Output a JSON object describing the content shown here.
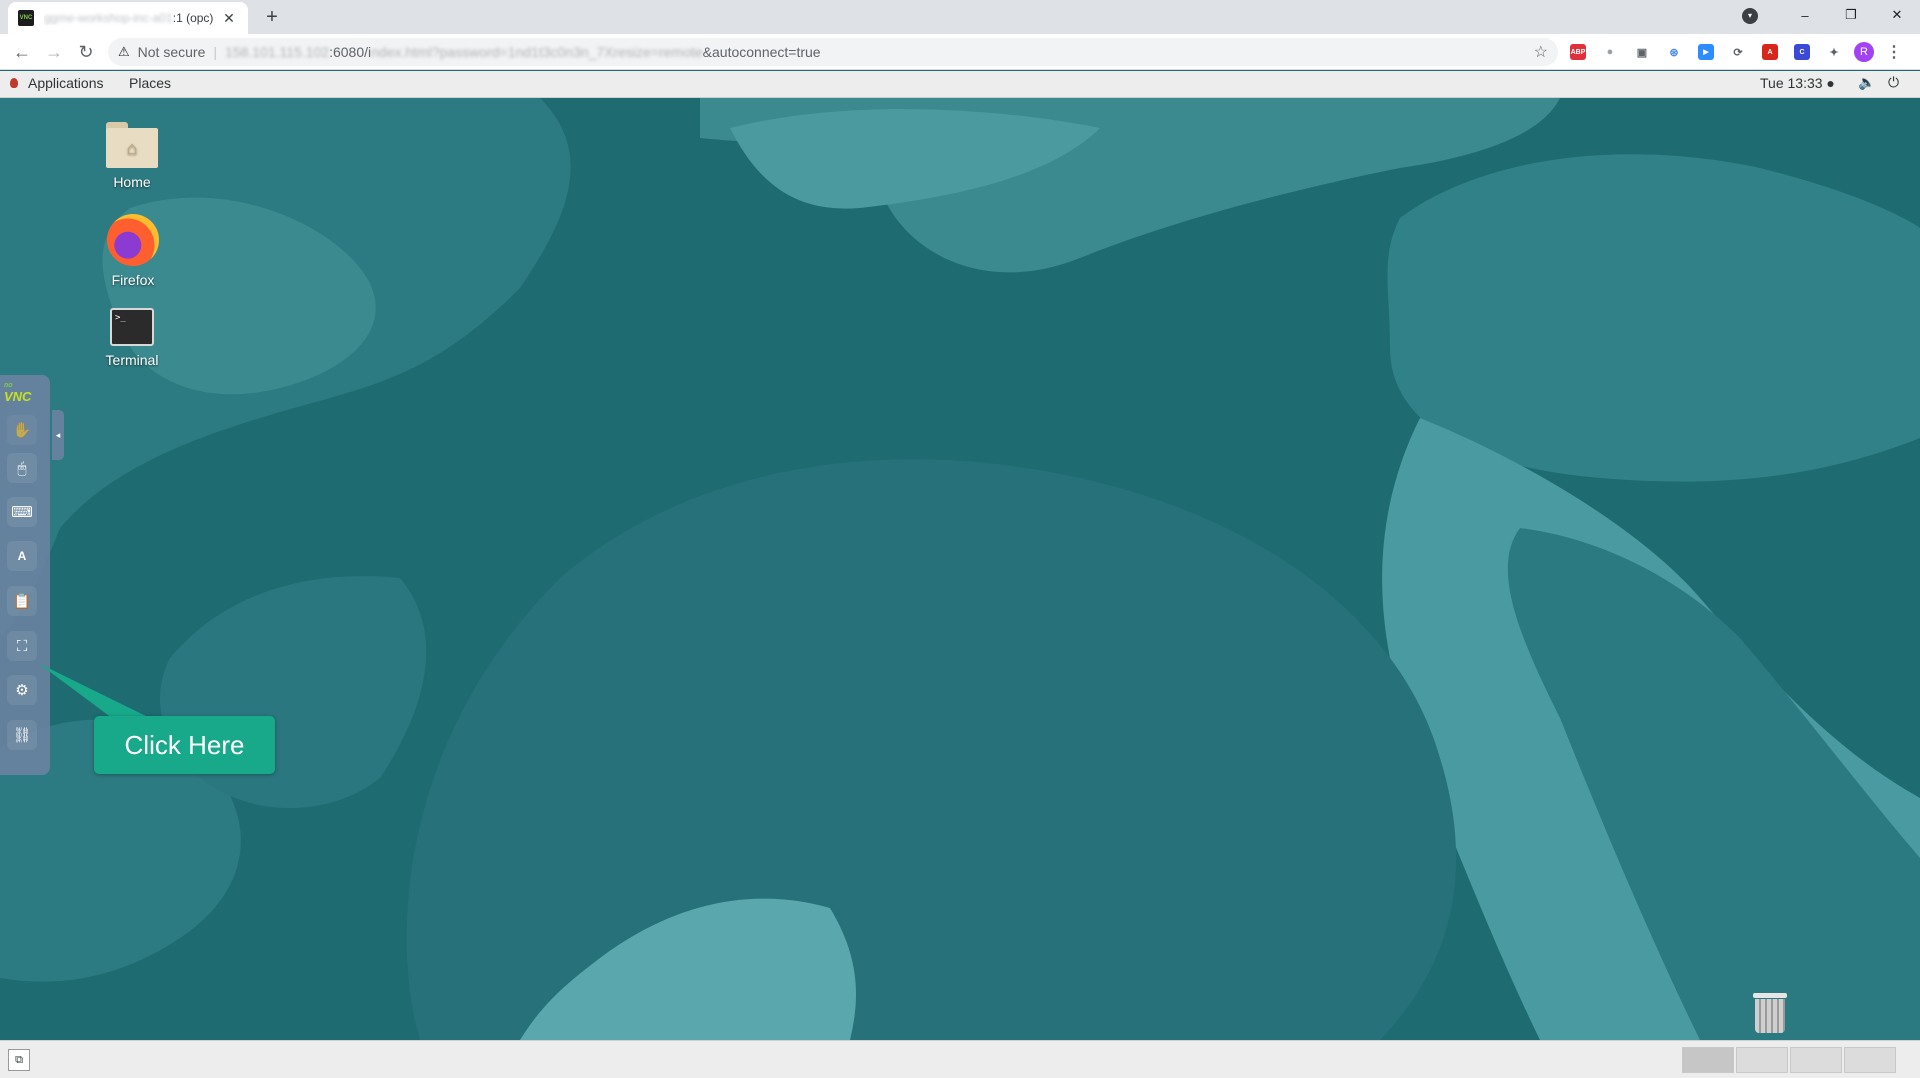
{
  "browser": {
    "tab": {
      "favicon_text": "VNC",
      "title_blurred": "ggme-workshop-inc-a01",
      "title_suffix": ":1 (opc)",
      "close": "✕"
    },
    "new_tab": "+",
    "window_controls": {
      "minimize": "–",
      "restore": "❐",
      "close": "✕"
    },
    "nav": {
      "back": "←",
      "forward": "→",
      "reload": "↻"
    },
    "address": {
      "security_icon": "⚠",
      "security_label": "Not secure",
      "separator": "|",
      "host_blurred": "158.101.115.102",
      "port_path": ":6080/i",
      "path_blurred": "ndex.html?password=1nd1t3c0n3n_7Xresize=remote",
      "query_tail": "&autoconnect=true"
    },
    "bookmark_star": "☆",
    "extensions": [
      {
        "name": "adblock-icon",
        "text": "ABP",
        "color": "#e0313a"
      },
      {
        "name": "speech-icon",
        "text": "●",
        "color": "#9aa0a6"
      },
      {
        "name": "capture-icon",
        "text": "▣",
        "color": "#5f6368"
      },
      {
        "name": "translate-icon",
        "text": "⊛",
        "color": "#4a8af4"
      },
      {
        "name": "zoom-icon",
        "text": "▶",
        "color": "#2d8cff"
      },
      {
        "name": "sync-icon",
        "text": "⟳",
        "color": "#5f6368"
      },
      {
        "name": "pdf-icon",
        "text": "A",
        "color": "#d9261c"
      },
      {
        "name": "c-extension-icon",
        "text": "C",
        "color": "#3a49d6"
      },
      {
        "name": "puzzle-icon",
        "text": "✦",
        "color": "#5f6368"
      }
    ],
    "profile_initial": "R",
    "menu": "⋮"
  },
  "gnome": {
    "applications": "Applications",
    "places": "Places",
    "clock": "Tue 13:33 ●",
    "volume_icon": "🔈",
    "power_icon": "⏻"
  },
  "desktop_icons": {
    "home": "Home",
    "firefox": "Firefox",
    "terminal": "Terminal",
    "terminal_prompt": ">_"
  },
  "novnc": {
    "logo_top": "no",
    "logo": "VNC",
    "handle": "◂",
    "buttons": [
      {
        "name": "drag-viewport-icon",
        "glyph": "✋"
      },
      {
        "name": "mouse-icon",
        "glyph": "🖱"
      },
      {
        "name": "keyboard-icon",
        "glyph": "⌨"
      },
      {
        "name": "extra-keys-icon",
        "glyph": "A"
      },
      {
        "name": "clipboard-icon",
        "glyph": "📋"
      },
      {
        "name": "fullscreen-icon",
        "glyph": "⛶"
      },
      {
        "name": "settings-icon",
        "glyph": "⚙"
      },
      {
        "name": "disconnect-icon",
        "glyph": "⛓"
      }
    ]
  },
  "callout": {
    "text": "Click Here"
  },
  "bottom_bar": {
    "show_desktop": "⧉",
    "workspaces": 4
  },
  "colors": {
    "desktop_teal": "#1f6b72",
    "callout_green": "#17a98a"
  }
}
